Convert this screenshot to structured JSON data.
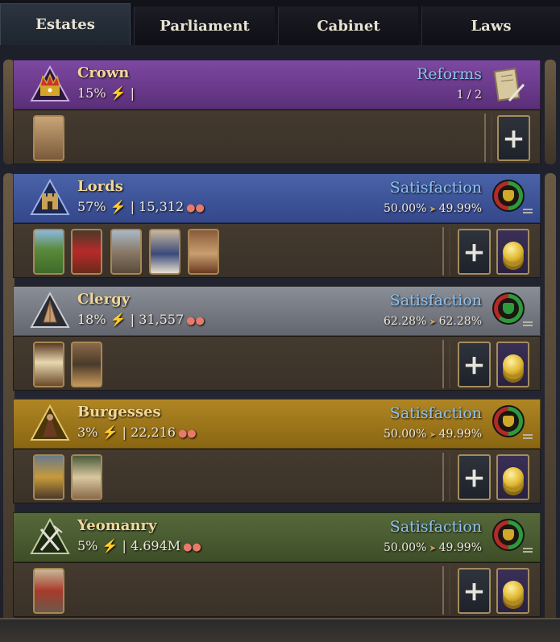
{
  "tabs": [
    {
      "label": "Estates",
      "active": true
    },
    {
      "label": "Parliament",
      "active": false
    },
    {
      "label": "Cabinet",
      "active": false
    },
    {
      "label": "Laws",
      "active": false
    }
  ],
  "crown": {
    "name": "Crown",
    "percent": "15%",
    "right_title": "Reforms",
    "right_sub": "1 / 2",
    "color": "#6b3b8c",
    "emblem_icon": "crown-icon",
    "cards": [
      "scribe-card"
    ]
  },
  "lords": {
    "name": "Lords",
    "percent": "57%",
    "population": "15,312",
    "right_title": "Satisfaction",
    "sat_current": "50.00%",
    "sat_target": "49.99%",
    "color": "#3d5597",
    "emblem_icon": "castle-icon",
    "cards": [
      "countryside-card",
      "noble-lady-card",
      "castle-tower-card",
      "wedding-card",
      "scroll-card"
    ]
  },
  "clergy": {
    "name": "Clergy",
    "percent": "18%",
    "population": "31,557",
    "right_title": "Satisfaction",
    "sat_current": "62.28%",
    "sat_target": "62.28%",
    "color": "#7a7e86",
    "emblem_icon": "praying-hands-icon",
    "cards": [
      "holy-book-card",
      "monk-card"
    ]
  },
  "burgesses": {
    "name": "Burgesses",
    "percent": "3%",
    "population": "22,216",
    "right_title": "Satisfaction",
    "sat_current": "50.00%",
    "sat_target": "49.99%",
    "color": "#a27a1c",
    "emblem_icon": "merchant-icon",
    "cards": [
      "guild-shield-card",
      "market-card"
    ]
  },
  "yeomanry": {
    "name": "Yeomanry",
    "percent": "5%",
    "population": "4.694M",
    "right_title": "Satisfaction",
    "sat_current": "50.00%",
    "sat_target": "49.99%",
    "color": "#495a30",
    "emblem_icon": "pitchfork-icon",
    "cards": [
      "archer-card"
    ]
  }
}
